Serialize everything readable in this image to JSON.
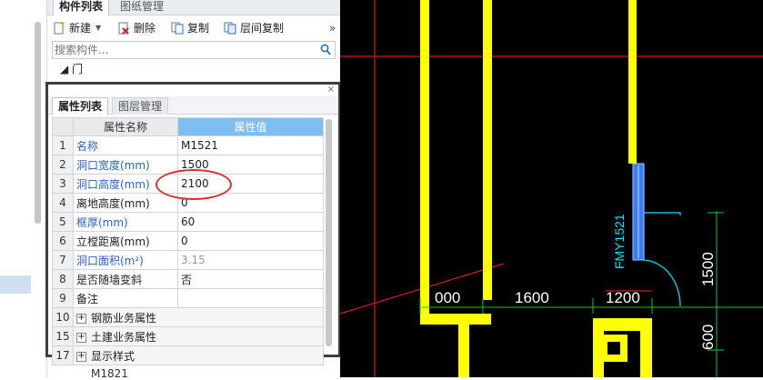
{
  "component_panel": {
    "tabs": [
      "构件列表",
      "图纸管理"
    ],
    "toolbar": {
      "new": "新建",
      "delete": "删除",
      "copy": "复制",
      "layer_copy": "层间复制",
      "more": "»"
    },
    "search": {
      "placeholder": "搜索构件..."
    },
    "tree": {
      "category": "◢ 门",
      "items": [
        "M1521",
        "M1821"
      ]
    }
  },
  "property_panel": {
    "close": "×",
    "tabs": [
      "属性列表",
      "图层管理"
    ],
    "headers": {
      "name": "属性名称",
      "value": "属性值"
    },
    "rows": [
      {
        "num": "1",
        "name": "名称",
        "value": "M1521"
      },
      {
        "num": "2",
        "name": "洞口宽度(mm)",
        "value": "1500"
      },
      {
        "num": "3",
        "name": "洞口高度(mm)",
        "value": "2100"
      },
      {
        "num": "4",
        "name": "离地高度(mm)",
        "value": "0"
      },
      {
        "num": "5",
        "name": "框厚(mm)",
        "value": "60"
      },
      {
        "num": "6",
        "name": "立樘距离(mm)",
        "value": "0"
      },
      {
        "num": "7",
        "name": "洞口面积(m²)",
        "value": "3.15"
      },
      {
        "num": "8",
        "name": "是否随墙变斜",
        "value": "否"
      },
      {
        "num": "9",
        "name": "备注",
        "value": ""
      },
      {
        "num": "10",
        "name": "钢筋业务属性",
        "value": ""
      },
      {
        "num": "15",
        "name": "土建业务属性",
        "value": ""
      },
      {
        "num": "17",
        "name": "显示样式",
        "value": ""
      }
    ]
  },
  "cad": {
    "door_label": "FMY1521",
    "dimensions": [
      "000",
      "1600",
      "1200",
      "1500",
      "600"
    ],
    "colors": {
      "background": "#000000",
      "wall": "#ffff00",
      "dimension": "#00cc33",
      "door": "#3a7bff",
      "swing": "#00e5ff",
      "redline": "#ff2020"
    }
  }
}
